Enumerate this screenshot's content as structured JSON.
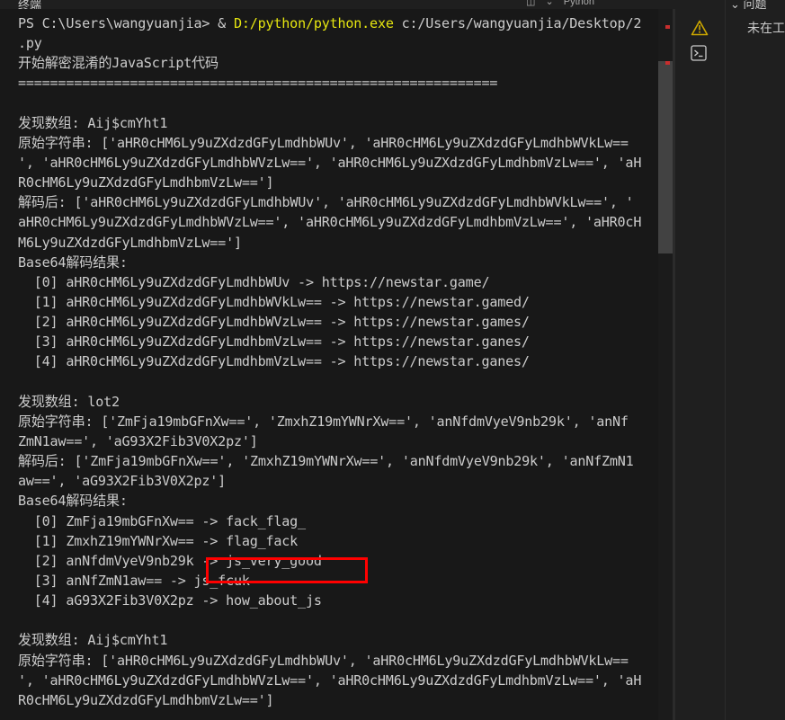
{
  "topbar": {
    "panel_title": "终端",
    "python_label": "Python",
    "problems_label": "问题"
  },
  "terminal": {
    "command": {
      "prompt": "PS C:\\Users\\wangyuanjia> & ",
      "exe": "D:/python/python.exe",
      "args": " c:/Users/wangyuanjia/Desktop/2"
    },
    "lines": [
      ".py",
      "开始解密混淆的JavaScript代码",
      "============================================================",
      "",
      "发现数组: Aij$cmYht1",
      "原始字符串: ['aHR0cHM6Ly9uZXdzdGFyLmdhbWUv', 'aHR0cHM6Ly9uZXdzdGFyLmdhbWVkLw==",
      "', 'aHR0cHM6Ly9uZXdzdGFyLmdhbWVzLw==', 'aHR0cHM6Ly9uZXdzdGFyLmdhbmVzLw==', 'aH",
      "R0cHM6Ly9uZXdzdGFyLmdhbmVzLw==']",
      "解码后: ['aHR0cHM6Ly9uZXdzdGFyLmdhbWUv', 'aHR0cHM6Ly9uZXdzdGFyLmdhbWVkLw==', '",
      "aHR0cHM6Ly9uZXdzdGFyLmdhbWVzLw==', 'aHR0cHM6Ly9uZXdzdGFyLmdhbmVzLw==', 'aHR0cH",
      "M6Ly9uZXdzdGFyLmdhbmVzLw==']",
      "Base64解码结果:",
      "  [0] aHR0cHM6Ly9uZXdzdGFyLmdhbWUv -> https://newstar.game/",
      "  [1] aHR0cHM6Ly9uZXdzdGFyLmdhbWVkLw== -> https://newstar.gamed/",
      "  [2] aHR0cHM6Ly9uZXdzdGFyLmdhbWVzLw== -> https://newstar.games/",
      "  [3] aHR0cHM6Ly9uZXdzdGFyLmdhbmVzLw== -> https://newstar.ganes/",
      "  [4] aHR0cHM6Ly9uZXdzdGFyLmdhbmVzLw== -> https://newstar.ganes/",
      "",
      "发现数组: lot2",
      "原始字符串: ['ZmFja19mbGFnXw==', 'ZmxhZ19mYWNrXw==', 'anNfdmVyeV9nb29k', 'anNf",
      "ZmN1aw==', 'aG93X2Fib3V0X2pz']",
      "解码后: ['ZmFja19mbGFnXw==', 'ZmxhZ19mYWNrXw==', 'anNfdmVyeV9nb29k', 'anNfZmN1",
      "aw==', 'aG93X2Fib3V0X2pz']",
      "Base64解码结果:",
      "  [0] ZmFja19mbGFnXw== -> fack_flag_",
      "  [1] ZmxhZ19mYWNrXw== -> flag_fack",
      "  [2] anNfdmVyeV9nb29k -> js_very_good",
      "  [3] anNfZmN1aw== -> js_fcuk",
      "  [4] aG93X2Fib3V0X2pz -> how_about_js",
      "",
      "发现数组: Aij$cmYht1",
      "原始字符串: ['aHR0cHM6Ly9uZXdzdGFyLmdhbWUv', 'aHR0cHM6Ly9uZXdzdGFyLmdhbWVkLw==",
      "', 'aHR0cHM6Ly9uZXdzdGFyLmdhbWVzLw==', 'aHR0cHM6Ly9uZXdzdGFyLmdhbmVzLw==', 'aH",
      "R0cHM6Ly9uZXdzdGFyLmdhbmVzLw==']"
    ]
  },
  "side": {
    "warning_icon": "warning-icon",
    "terminal_icon": "terminal-icon"
  },
  "problems": {
    "message": "未在工作区检测到问题"
  },
  "colors": {
    "terminal_bg": "#181818",
    "text": "#cccccc",
    "exe_path": "#e5e510",
    "warning": "#cca700",
    "highlight_box": "#ff0000"
  }
}
